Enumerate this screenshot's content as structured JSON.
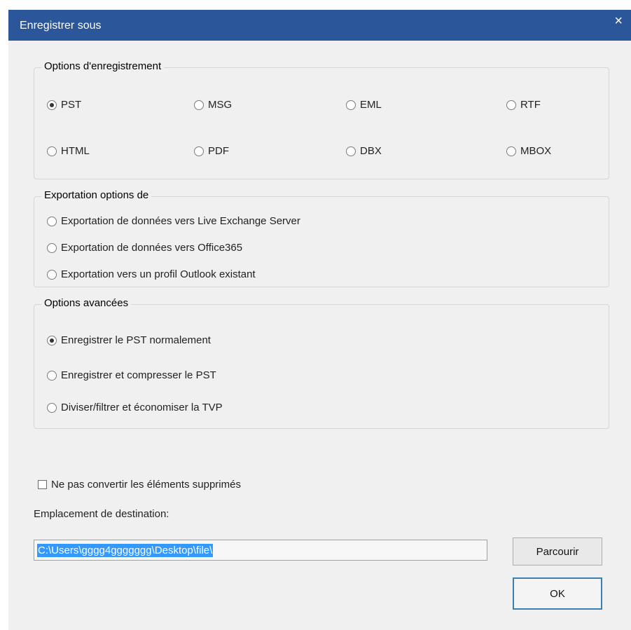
{
  "dialog": {
    "title": "Enregistrer sous",
    "close_glyph": "×"
  },
  "save_options": {
    "legend": "Options d'enregistrement",
    "formats": [
      {
        "label": "PST",
        "checked": true
      },
      {
        "label": "MSG",
        "checked": false
      },
      {
        "label": "EML",
        "checked": false
      },
      {
        "label": "RTF",
        "checked": false
      },
      {
        "label": "HTML",
        "checked": false
      },
      {
        "label": "PDF",
        "checked": false
      },
      {
        "label": "DBX",
        "checked": false
      },
      {
        "label": "MBOX",
        "checked": false
      }
    ]
  },
  "export_options": {
    "legend": "Exportation options de",
    "items": [
      {
        "label": "Exportation de données vers Live Exchange Server",
        "checked": false
      },
      {
        "label": "Exportation de données vers Office365",
        "checked": false
      },
      {
        "label": "Exportation vers un profil Outlook existant",
        "checked": false
      }
    ]
  },
  "advanced_options": {
    "legend": "Options avancées",
    "items": [
      {
        "label": "Enregistrer le PST normalement",
        "checked": true
      },
      {
        "label": "Enregistrer et compresser le PST",
        "checked": false
      },
      {
        "label": "Diviser/filtrer et économiser la TVP",
        "checked": false
      }
    ]
  },
  "checkbox": {
    "label": "Ne pas convertir les éléments supprimés",
    "checked": false
  },
  "destination": {
    "label": "Emplacement de destination:",
    "path": "C:\\Users\\gggg4ggggggg\\Desktop\\file\\"
  },
  "buttons": {
    "browse": "Parcourir",
    "ok": "OK"
  }
}
